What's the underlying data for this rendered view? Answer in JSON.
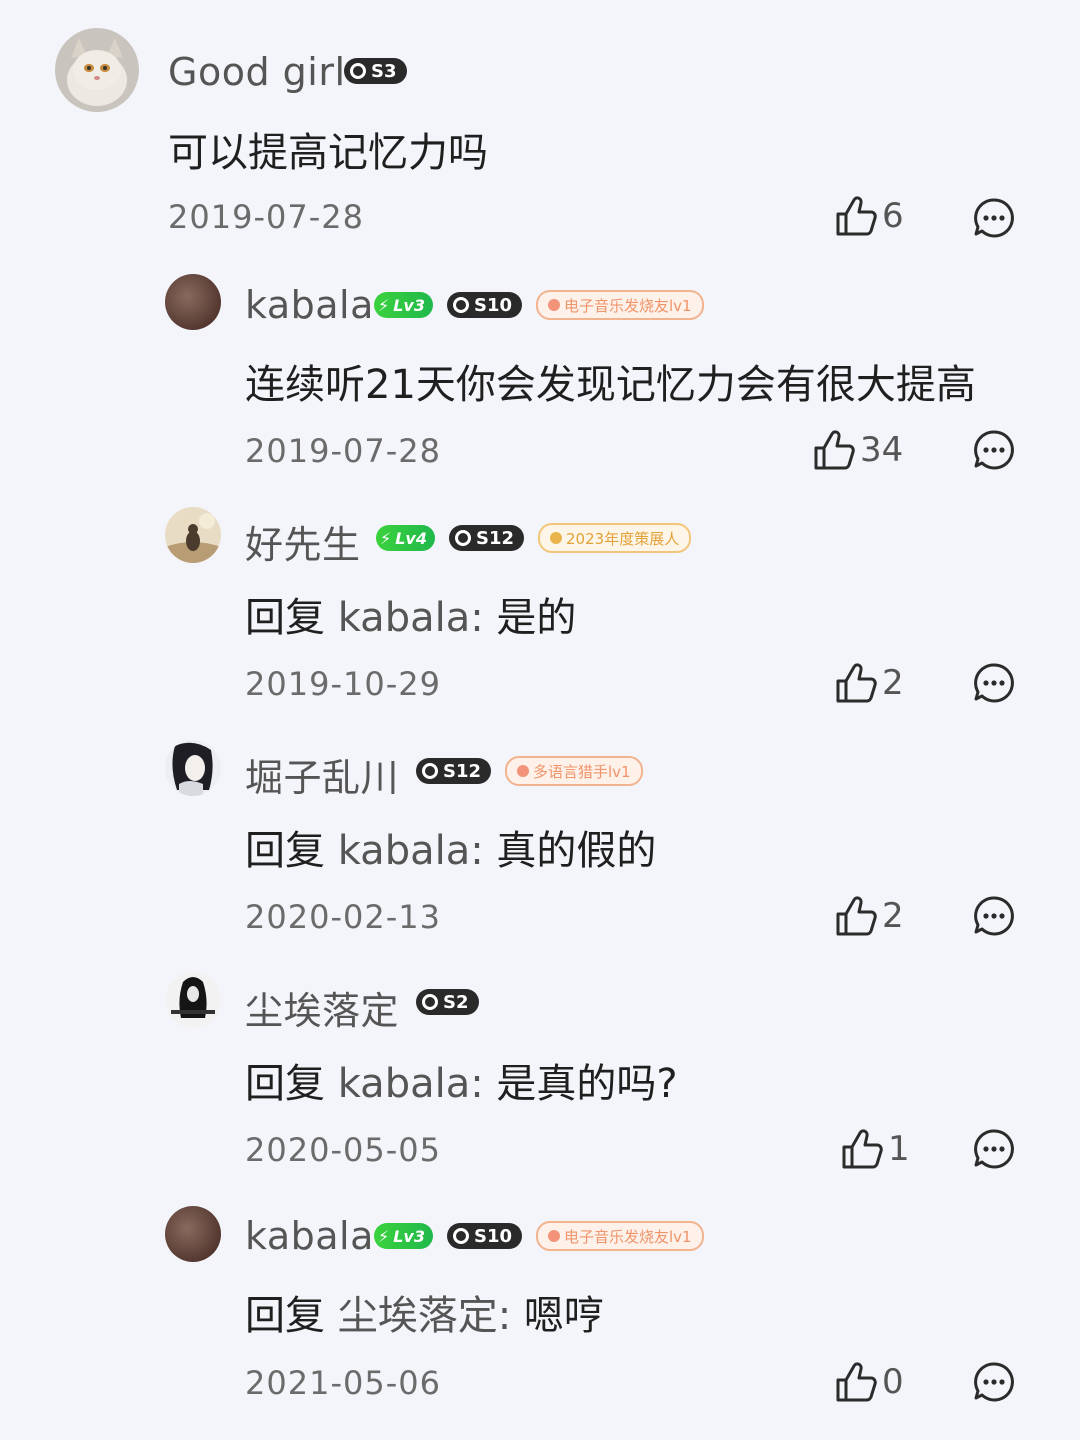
{
  "comments": [
    {
      "username": "Good girl",
      "s_badge": "S3",
      "text": "可以提高记忆力吗",
      "date": "2019-07-28",
      "likes": "6"
    },
    {
      "username": "kabala",
      "lv_badge": "Lv3",
      "s_badge": "S10",
      "tag": "电子音乐发烧友lv1",
      "text": "连续听21天你会发现记忆力会有很大提高",
      "date": "2019-07-28",
      "likes": "34"
    },
    {
      "username": "好先生",
      "lv_badge": "Lv4",
      "s_badge": "S12",
      "tag": "2023年度策展人",
      "reply_prefix": "回复",
      "reply_target": "kabala:",
      "text": "是的",
      "date": "2019-10-29",
      "likes": "2"
    },
    {
      "username": "堀子乱川",
      "s_badge": "S12",
      "tag": "多语言猎手lv1",
      "reply_prefix": "回复",
      "reply_target": "kabala:",
      "text": "真的假的",
      "date": "2020-02-13",
      "likes": "2"
    },
    {
      "username": "尘埃落定",
      "s_badge": "S2",
      "reply_prefix": "回复",
      "reply_target": "kabala:",
      "text": "是真的吗?",
      "date": "2020-05-05",
      "likes": "1"
    },
    {
      "username": "kabala",
      "lv_badge": "Lv3",
      "s_badge": "S10",
      "tag": "电子音乐发烧友lv1",
      "reply_prefix": "回复",
      "reply_target": "尘埃落定:",
      "text": "嗯哼",
      "date": "2021-05-06",
      "likes": "0"
    }
  ],
  "icons": {
    "like": "thumbs-up-icon",
    "reply": "comment-bubble-icon",
    "bolt": "lightning-bolt-icon"
  },
  "colors": {
    "background": "#f3f5fa",
    "level_badge": "#2fc847",
    "tag_border": "#f2b38f",
    "tag_gold_border": "#f1c67a"
  }
}
